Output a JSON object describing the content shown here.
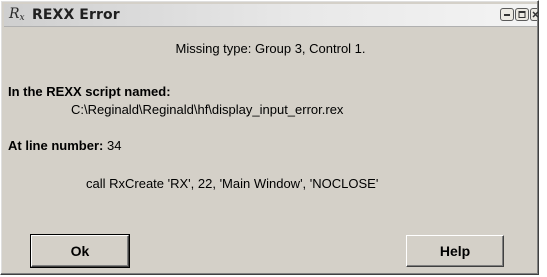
{
  "window": {
    "title": "REXX Error",
    "icon": "rx-icon",
    "controls": [
      "minimize-icon",
      "maximize-icon",
      "close-icon"
    ]
  },
  "dialog": {
    "message_title": "Missing type: Group 3, Control 1.",
    "script_label": "In the REXX script named:",
    "script_path": "C:\\Reginald\\Reginald\\hf\\display_input_error.rex",
    "line_label": "At line number:",
    "line_value": "34",
    "code_line": "call RxCreate 'RX', 22, 'Main Window', 'NOCLOSE'"
  },
  "buttons": {
    "ok_label": "Ok",
    "help_label": "Help"
  }
}
